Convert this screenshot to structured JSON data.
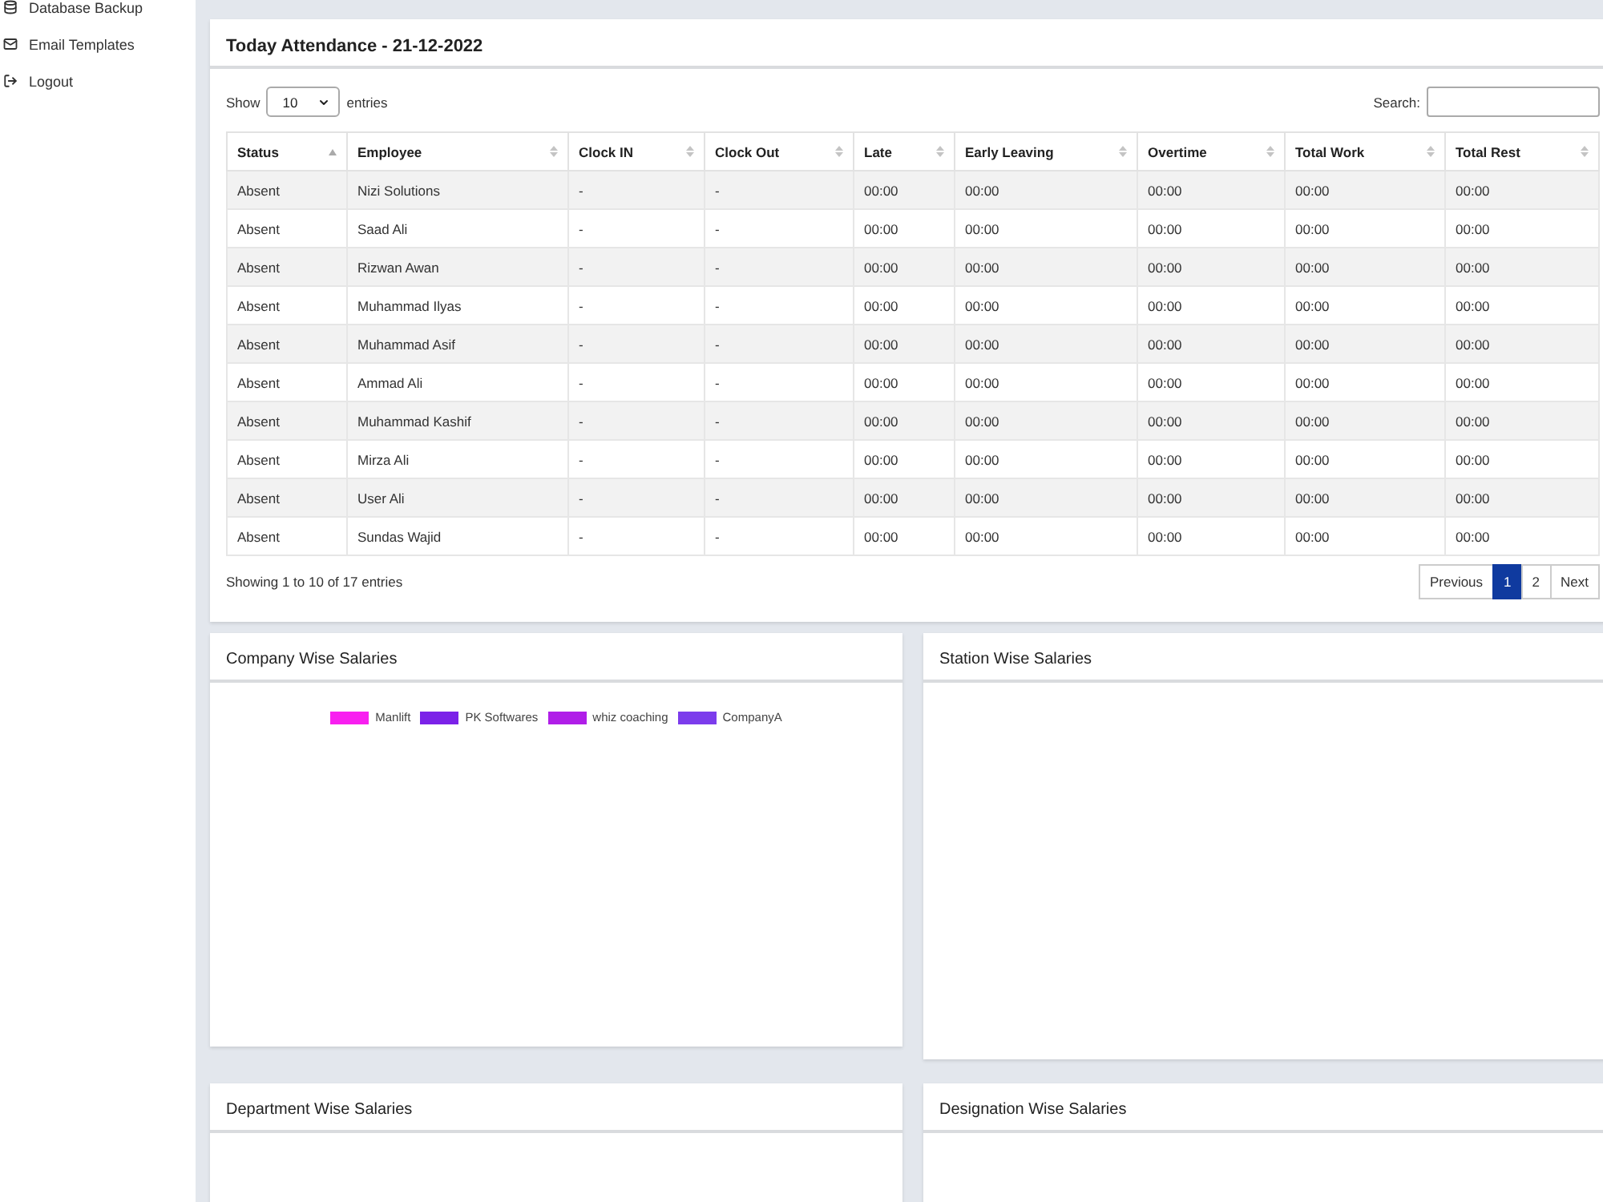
{
  "sidebar": {
    "items": [
      {
        "label": "Database Backup"
      },
      {
        "label": "Email Templates"
      },
      {
        "label": "Logout"
      }
    ]
  },
  "attendance": {
    "title": "Today Attendance - 21-12-2022",
    "length_menu": {
      "label_before": "Show",
      "value": "10",
      "label_after": "entries"
    },
    "search": {
      "label": "Search:"
    },
    "table": {
      "columns": [
        {
          "label": "Status",
          "sorted": true
        },
        {
          "label": "Employee",
          "sorted": false
        },
        {
          "label": "Clock IN",
          "sorted": false
        },
        {
          "label": "Clock Out",
          "sorted": false
        },
        {
          "label": "Late",
          "sorted": false
        },
        {
          "label": "Early Leaving",
          "sorted": false
        },
        {
          "label": "Overtime",
          "sorted": false
        },
        {
          "label": "Total Work",
          "sorted": false
        },
        {
          "label": "Total Rest",
          "sorted": false
        }
      ],
      "rows": [
        [
          "Absent",
          "Nizi Solutions",
          "-",
          "-",
          "00:00",
          "00:00",
          "00:00",
          "00:00",
          "00:00"
        ],
        [
          "Absent",
          "Saad Ali",
          "-",
          "-",
          "00:00",
          "00:00",
          "00:00",
          "00:00",
          "00:00"
        ],
        [
          "Absent",
          "Rizwan Awan",
          "-",
          "-",
          "00:00",
          "00:00",
          "00:00",
          "00:00",
          "00:00"
        ],
        [
          "Absent",
          "Muhammad Ilyas",
          "-",
          "-",
          "00:00",
          "00:00",
          "00:00",
          "00:00",
          "00:00"
        ],
        [
          "Absent",
          "Muhammad Asif",
          "-",
          "-",
          "00:00",
          "00:00",
          "00:00",
          "00:00",
          "00:00"
        ],
        [
          "Absent",
          "Ammad Ali",
          "-",
          "-",
          "00:00",
          "00:00",
          "00:00",
          "00:00",
          "00:00"
        ],
        [
          "Absent",
          "Muhammad Kashif",
          "-",
          "-",
          "00:00",
          "00:00",
          "00:00",
          "00:00",
          "00:00"
        ],
        [
          "Absent",
          "Mirza Ali",
          "-",
          "-",
          "00:00",
          "00:00",
          "00:00",
          "00:00",
          "00:00"
        ],
        [
          "Absent",
          "User Ali",
          "-",
          "-",
          "00:00",
          "00:00",
          "00:00",
          "00:00",
          "00:00"
        ],
        [
          "Absent",
          "Sundas Wajid",
          "-",
          "-",
          "00:00",
          "00:00",
          "00:00",
          "00:00",
          "00:00"
        ]
      ]
    },
    "info": "Showing 1 to 10 of 17 entries",
    "pagination": [
      {
        "label": "Previous",
        "selected": false
      },
      {
        "label": "1",
        "selected": true
      },
      {
        "label": "2",
        "selected": false
      },
      {
        "label": "Next",
        "selected": false
      }
    ]
  },
  "panels": [
    {
      "title": "Company Wise Salaries",
      "legend": [
        {
          "label": "Manlift",
          "color": "#f81ff0"
        },
        {
          "label": "PK Softwares",
          "color": "#7b22e8"
        },
        {
          "label": "whiz coaching",
          "color": "#b01ee8"
        },
        {
          "label": "CompanyA",
          "color": "#7c3cec"
        }
      ]
    },
    {
      "title": "Station Wise Salaries"
    },
    {
      "title": "Department Wise Salaries"
    },
    {
      "title": "Designation Wise Salaries"
    }
  ]
}
